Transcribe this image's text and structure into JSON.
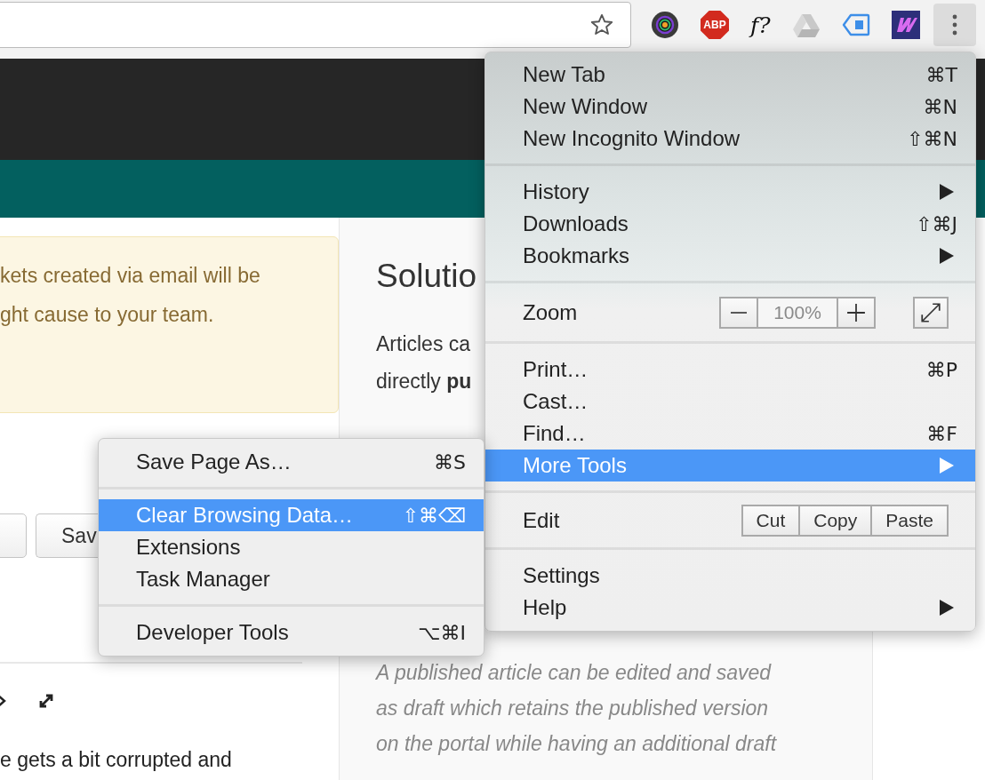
{
  "extensions": [
    {
      "kind": "lens"
    },
    {
      "kind": "abp",
      "label": "ABP"
    },
    {
      "kind": "text",
      "label": "f?"
    },
    {
      "kind": "drive"
    },
    {
      "kind": "tag"
    },
    {
      "kind": "logo"
    }
  ],
  "alert": {
    "lines": [
      "kets created via email will be",
      "ght cause to your team."
    ]
  },
  "buttons": [
    {
      "kind": "cut"
    },
    {
      "kind": "label",
      "label": "Sav"
    }
  ],
  "editor_text": "e gets a bit corrupted and",
  "article": {
    "heading": "Solutio",
    "lines": [
      "Articles ca",
      "directly **pu**"
    ],
    "note_lines": [
      "A published article can be edited and saved",
      "as draft which retains the published version",
      "on the portal while having an additional draft"
    ]
  },
  "menu": {
    "groups": [
      {
        "items": [
          {
            "kind": "item",
            "label": "New Tab",
            "shortcut": "⌘T",
            "has_submenu": false,
            "selected": false
          },
          {
            "kind": "item",
            "label": "New Window",
            "shortcut": "⌘N",
            "has_submenu": false,
            "selected": false
          },
          {
            "kind": "item",
            "label": "New Incognito Window",
            "shortcut": "⇧⌘N",
            "has_submenu": false,
            "selected": false
          }
        ]
      },
      {
        "items": [
          {
            "kind": "item",
            "label": "History",
            "has_submenu": true,
            "selected": false
          },
          {
            "kind": "item",
            "label": "Downloads",
            "shortcut": "⇧⌘J",
            "has_submenu": false,
            "selected": false
          },
          {
            "kind": "item",
            "label": "Bookmarks",
            "has_submenu": true,
            "selected": false
          }
        ]
      },
      {
        "items": [
          {
            "kind": "zoom",
            "label": "Zoom",
            "value": "100%",
            "selected": false
          }
        ]
      },
      {
        "items": [
          {
            "kind": "item",
            "label": "Print…",
            "shortcut": "⌘P",
            "has_submenu": false,
            "selected": false
          },
          {
            "kind": "item",
            "label": "Cast…",
            "has_submenu": false,
            "selected": false
          },
          {
            "kind": "item",
            "label": "Find…",
            "shortcut": "⌘F",
            "has_submenu": false,
            "selected": false
          },
          {
            "kind": "item",
            "label": "More Tools",
            "has_submenu": true,
            "selected": true
          }
        ]
      },
      {
        "items": [
          {
            "kind": "edit",
            "label": "Edit",
            "actions": [
              "Cut",
              "Copy",
              "Paste"
            ],
            "selected": false
          }
        ]
      },
      {
        "items": [
          {
            "kind": "item",
            "label": "Settings",
            "has_submenu": false,
            "selected": false
          },
          {
            "kind": "item",
            "label": "Help",
            "has_submenu": true,
            "selected": false
          }
        ]
      }
    ]
  },
  "submenu": {
    "groups": [
      {
        "items": [
          {
            "label": "Save Page As…",
            "shortcut": "⌘S",
            "selected": false
          }
        ]
      },
      {
        "items": [
          {
            "label": "Clear Browsing Data…",
            "shortcut": "⇧⌘⌫",
            "selected": true
          },
          {
            "label": "Extensions",
            "selected": false
          },
          {
            "label": "Task Manager",
            "selected": false
          }
        ]
      },
      {
        "items": [
          {
            "label": "Developer Tools",
            "shortcut": "⌥⌘I",
            "selected": false
          }
        ]
      }
    ]
  }
}
